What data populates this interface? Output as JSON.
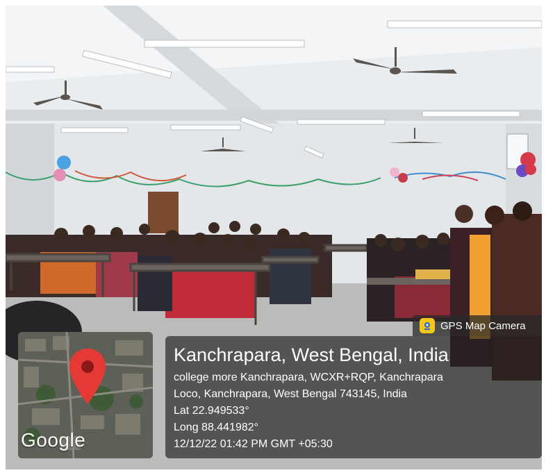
{
  "overlay": {
    "app_label": "GPS Map Camera",
    "app_icon": "gps-map-camera-icon",
    "title": "Kanchrapara, West Bengal, India",
    "address_line_1": "college more Kanchrapara, WCXR+RQP, Kanchrapara",
    "address_line_2": "Loco, Kanchrapara, West Bengal 743145, India",
    "latitude": "Lat 22.949533°",
    "longitude": "Long 88.441982°",
    "datetime": "12/12/22 01:42 PM GMT +05:30",
    "map_brand": "Google",
    "pin_icon": "location-pin-icon"
  },
  "colors": {
    "pin_red": "#e53935",
    "badge_yellow": "#f5c518",
    "overlay_dark": "#1e1e1e"
  }
}
